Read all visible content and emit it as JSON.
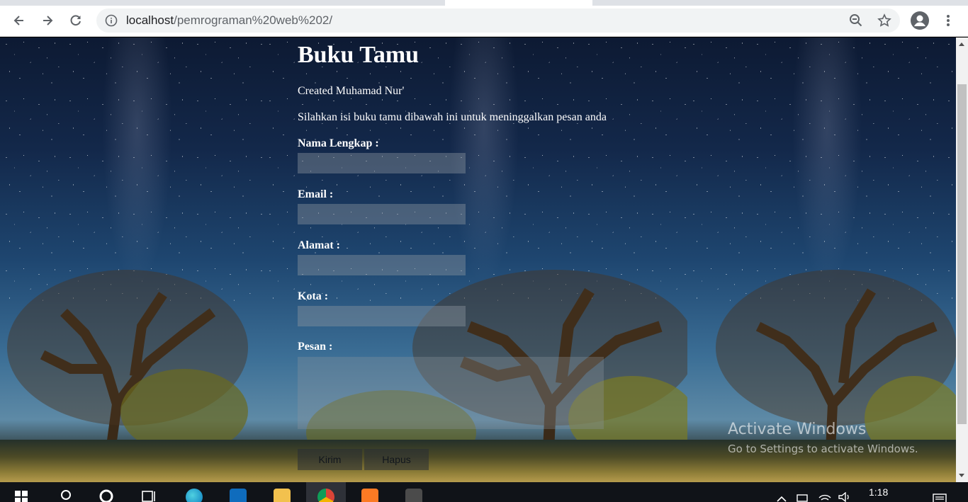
{
  "browser": {
    "url_host": "localhost",
    "url_path": "/pemrograman%20web%202/"
  },
  "page": {
    "title": "Buku Tamu",
    "author": "Created Muhamad Nur'",
    "intro": "Silahkan isi buku tamu dibawah ini untuk meninggalkan pesan anda",
    "fields": [
      {
        "label": "Nama Lengkap :",
        "value": ""
      },
      {
        "label": "Email :",
        "value": ""
      },
      {
        "label": "Alamat :",
        "value": ""
      },
      {
        "label": "Kota :",
        "value": ""
      }
    ],
    "message_label": "Pesan :",
    "submit_label": "Kirim",
    "reset_label": "Hapus"
  },
  "watermark": {
    "line1": "Activate Windows",
    "line2": "Go to Settings to activate Windows."
  },
  "taskbar": {
    "time": "1:18",
    "apps": [
      "windows-start",
      "search",
      "cortana",
      "task-view",
      "edge",
      "mail",
      "file-explorer",
      "chrome",
      "xampp",
      "sublime-text"
    ]
  },
  "colors": {
    "accent_chrome_bg": "#f1f3f4",
    "taskbar": "#101318"
  }
}
